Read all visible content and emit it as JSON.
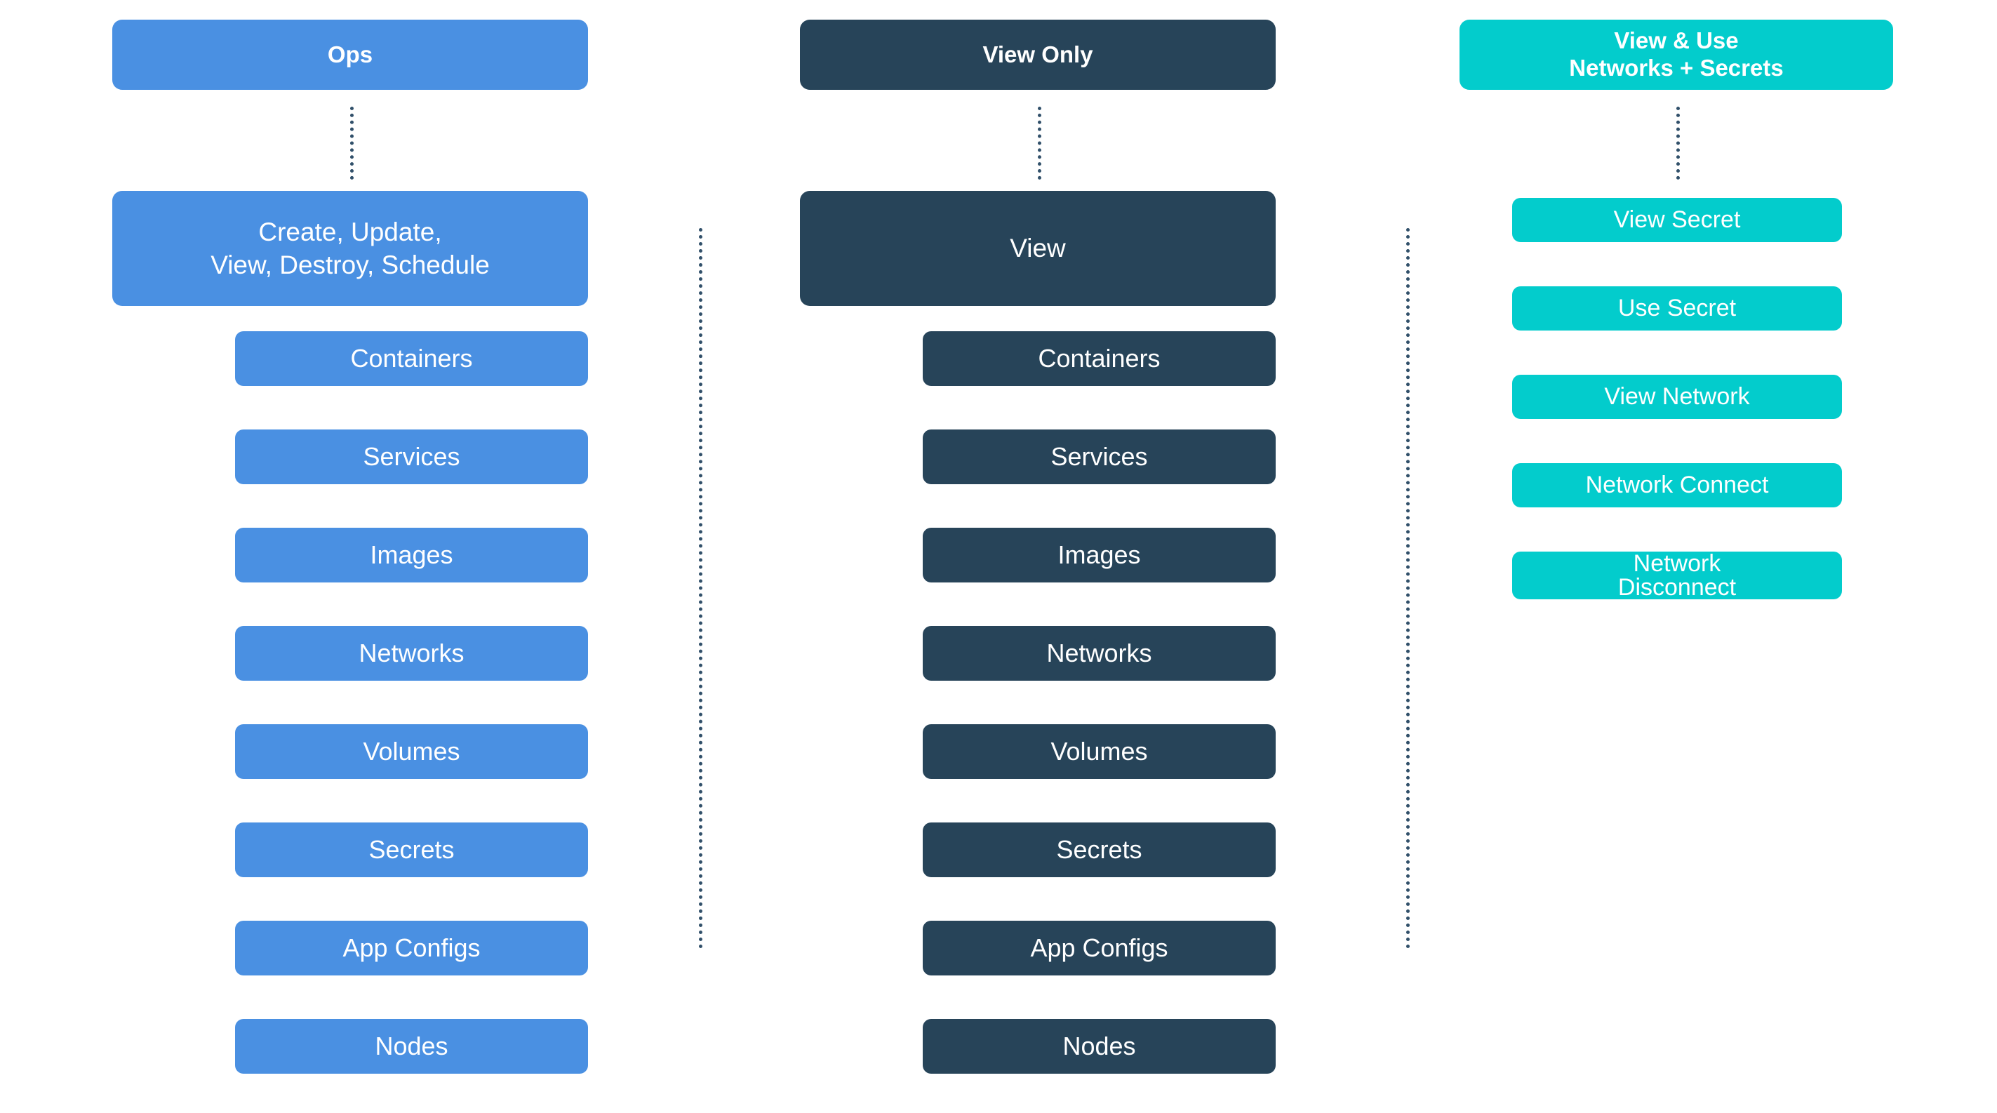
{
  "palette": {
    "ops_blue": "#4a90e2",
    "view_navy": "#274459",
    "teal": "#03cccc",
    "dotted_line": "#31506a",
    "background": "#ffffff",
    "text_on_box": "#ffffff"
  },
  "columns": {
    "ops": {
      "header": "Ops",
      "main": "Create, Update,\nView, Destroy, Schedule",
      "items": [
        "Containers",
        "Services",
        "Images",
        "Networks",
        "Volumes",
        "Secrets",
        "App Configs",
        "Nodes"
      ]
    },
    "view_only": {
      "header": "View Only",
      "main": "View",
      "items": [
        "Containers",
        "Services",
        "Images",
        "Networks",
        "Volumes",
        "Secrets",
        "App Configs",
        "Nodes"
      ]
    },
    "view_use": {
      "header": "View & Use\nNetworks + Secrets",
      "items": [
        "View Secret",
        "Use Secret",
        "View Network",
        "Network Connect",
        "Network\nDisconnect"
      ]
    }
  }
}
